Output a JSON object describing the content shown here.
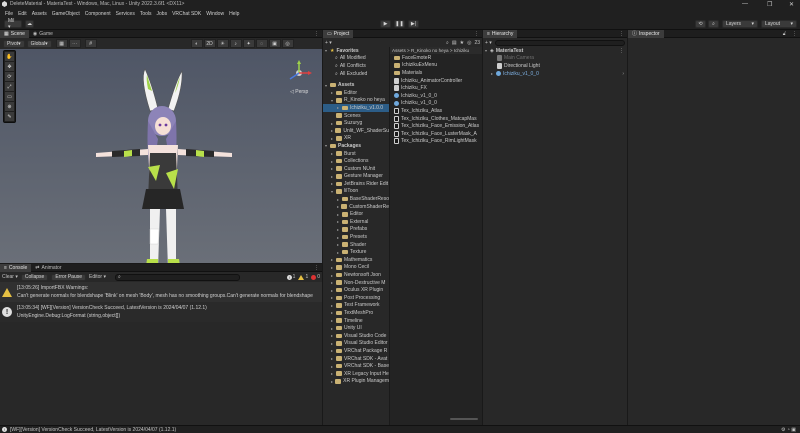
{
  "window": {
    "title": "DeleteMaterial - MateriaTest - Windows, Mac, Linux - Unity 2022.3.6f1 <DX11>",
    "min": "—",
    "max": "❐",
    "close": "✕"
  },
  "menu": [
    "File",
    "Edit",
    "Assets",
    "GameObject",
    "Component",
    "Services",
    "Tools",
    "Jobs",
    "VRChat SDK",
    "Window",
    "Help"
  ],
  "toolbar": {
    "account": "Mil ▾",
    "layers": "Layers",
    "layout": "Layout"
  },
  "scene": {
    "tabs": [
      "Scene",
      "Game"
    ],
    "pivot": "Pivot",
    "global": "Global",
    "persp": "◁ Persp"
  },
  "project": {
    "tab": "Project",
    "count": "23",
    "breadcrumb": "Assets > R_Kinoko no heya > Ichiziku",
    "favorites_label": "Favorites",
    "favorites": [
      "All Modified",
      "All Conflicts",
      "All Excluded"
    ],
    "assets_label": "Assets",
    "assets": [
      {
        "name": "Editor",
        "indent": 1,
        "tri": "▸"
      },
      {
        "name": "R_Kinoko no heya",
        "indent": 1,
        "tri": "▾"
      },
      {
        "name": "Ichiziku_v1.0.0",
        "indent": 2,
        "tri": "▸",
        "selected": true
      },
      {
        "name": "Scenes",
        "indent": 1,
        "tri": ""
      },
      {
        "name": "Suzuryg",
        "indent": 1,
        "tri": "▸"
      },
      {
        "name": "Unlit_WF_ShaderSu",
        "indent": 1,
        "tri": "▸"
      },
      {
        "name": "XR",
        "indent": 1,
        "tri": "▸"
      }
    ],
    "packages_label": "Packages",
    "packages": [
      "Burst",
      "Collections",
      "Custom NUnit",
      "Gesture Manager",
      "JetBrains Rider Edit",
      "lilToon",
      "BaseShaderReso",
      "CustomShaderRe",
      "Editor",
      "External",
      "Prefabs",
      "Presets",
      "Shader",
      "Texture",
      "Mathematics",
      "Mono Cecil",
      "Newtonsoft Json",
      "Non-Destructive M",
      "Oculus XR Plugin",
      "Post Processing",
      "Test Framework",
      "TextMeshPro",
      "Timeline",
      "Unity UI",
      "Visual Studio Code",
      "Visual Studio Editor",
      "VRChat Package R",
      "VRChat SDK - Avat",
      "VRChat SDK - Base",
      "XR Legacy Input He",
      "XR Plugin Managem"
    ],
    "files": [
      {
        "name": "FaceEmoteR",
        "kind": "folder"
      },
      {
        "name": "IchizikuExMenu",
        "kind": "folder"
      },
      {
        "name": "Materials",
        "kind": "folder"
      },
      {
        "name": "Ichiziku_AnimatorController",
        "kind": "file"
      },
      {
        "name": "Ichiziku_FX",
        "kind": "file"
      },
      {
        "name": "Ichiziku_v1_0_0",
        "kind": "blue"
      },
      {
        "name": "Ichiziku_v1_0_0",
        "kind": "blue"
      },
      {
        "name": "Tex_Ichiziku_Atlas",
        "kind": "dark"
      },
      {
        "name": "Tex_Ichiziku_Clothes_MatcapMas",
        "kind": "dark"
      },
      {
        "name": "Tex_Ichiziku_Face_Emission_Atlas",
        "kind": "dark"
      },
      {
        "name": "Tex_Ichiziku_Face_LusterMask_A",
        "kind": "dark"
      },
      {
        "name": "Tex_Ichiziku_Face_RimLightMask",
        "kind": "dark"
      }
    ]
  },
  "hierarchy": {
    "tab": "Hierarchy",
    "scene": "MateriaTest",
    "items": [
      {
        "name": "Main Camera",
        "disabled": true
      },
      {
        "name": "Directional Light",
        "disabled": false
      },
      {
        "name": "Ichiziku_v1_0_0",
        "disabled": false,
        "blue": true
      }
    ]
  },
  "inspector": {
    "tab": "Inspector"
  },
  "console": {
    "tabs": [
      "Console",
      "Animator"
    ],
    "clear": "Clear ▾",
    "collapse": "Collapse",
    "error_pause": "Error Pause",
    "editor": "Editor ▾",
    "counts": {
      "info": "1",
      "warn": "1",
      "error": "0"
    },
    "logs": [
      {
        "type": "warn",
        "line1": "[13:05:26] ImportFBX Warnings:",
        "line2": "Can't generate normals for blendshape 'Blink' on mesh 'Body', mesh has no smoothing groups.Can't generate normals for blendshape"
      },
      {
        "type": "info",
        "line1": "[13:05:34] [WF][Version] VersionCheck Succeed, LatestVersion is 2024/04/07 (1.12.1)",
        "line2": "UnityEngine.Debug:LogFormat (string,object[])"
      }
    ]
  },
  "status": "[WF][Version] VersionCheck Succeed, LatestVersion is 2024/04/07 (1.12.1)",
  "colors": {
    "accent": "#2c5d87",
    "scene_bg": "#5a6070",
    "warn": "#e6c043"
  }
}
